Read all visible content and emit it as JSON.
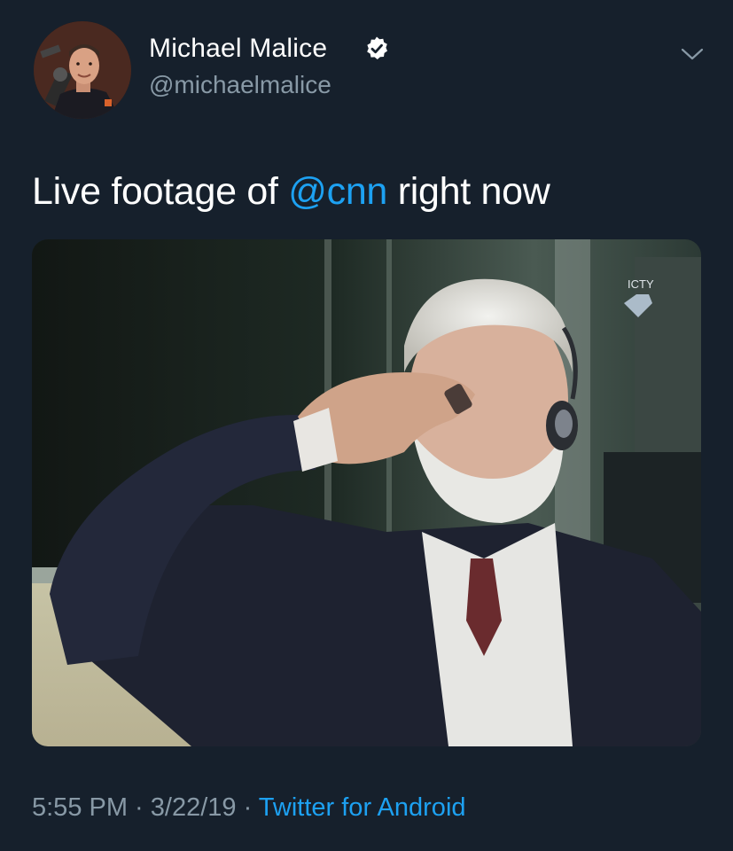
{
  "author": {
    "display_name": "Michael Malice",
    "handle": "@michaelmalice",
    "verified": true,
    "avatar_icon": "profile-photo"
  },
  "tweet": {
    "text_before": "Live footage of ",
    "mention": "@cnn",
    "text_after": " right now"
  },
  "media": {
    "watermark": "ICTY",
    "description_icon": "video-still-image"
  },
  "footer": {
    "time": "5:55 PM",
    "separator1": " · ",
    "date": "3/22/19",
    "separator2": " · ",
    "source": "Twitter for Android"
  },
  "colors": {
    "background": "#16202c",
    "link": "#1da1f2",
    "muted": "#8899a6",
    "text": "#ffffff"
  },
  "icons": {
    "verified": "verified-badge-icon",
    "menu": "chevron-down-icon"
  }
}
